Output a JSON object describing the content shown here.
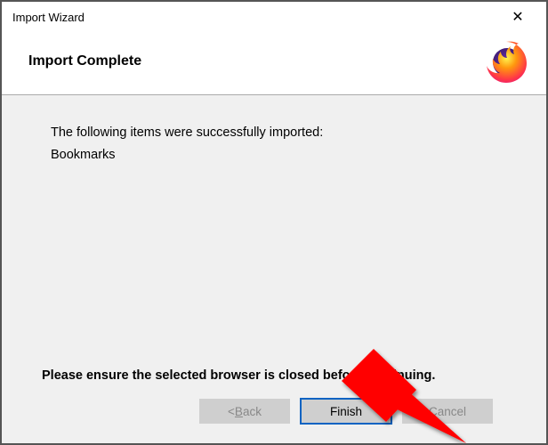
{
  "window": {
    "title": "Import Wizard"
  },
  "header": {
    "title": "Import Complete"
  },
  "body": {
    "intro": "The following items were successfully imported:",
    "items": [
      "Bookmarks"
    ],
    "warning": "Please ensure the selected browser is closed before continuing."
  },
  "buttons": {
    "back_prefix": "< ",
    "back_mnemonic": "B",
    "back_suffix": "ack",
    "finish": "Finish",
    "cancel": "Cancel"
  },
  "icons": {
    "close": "✕",
    "logo": "firefox-logo"
  }
}
